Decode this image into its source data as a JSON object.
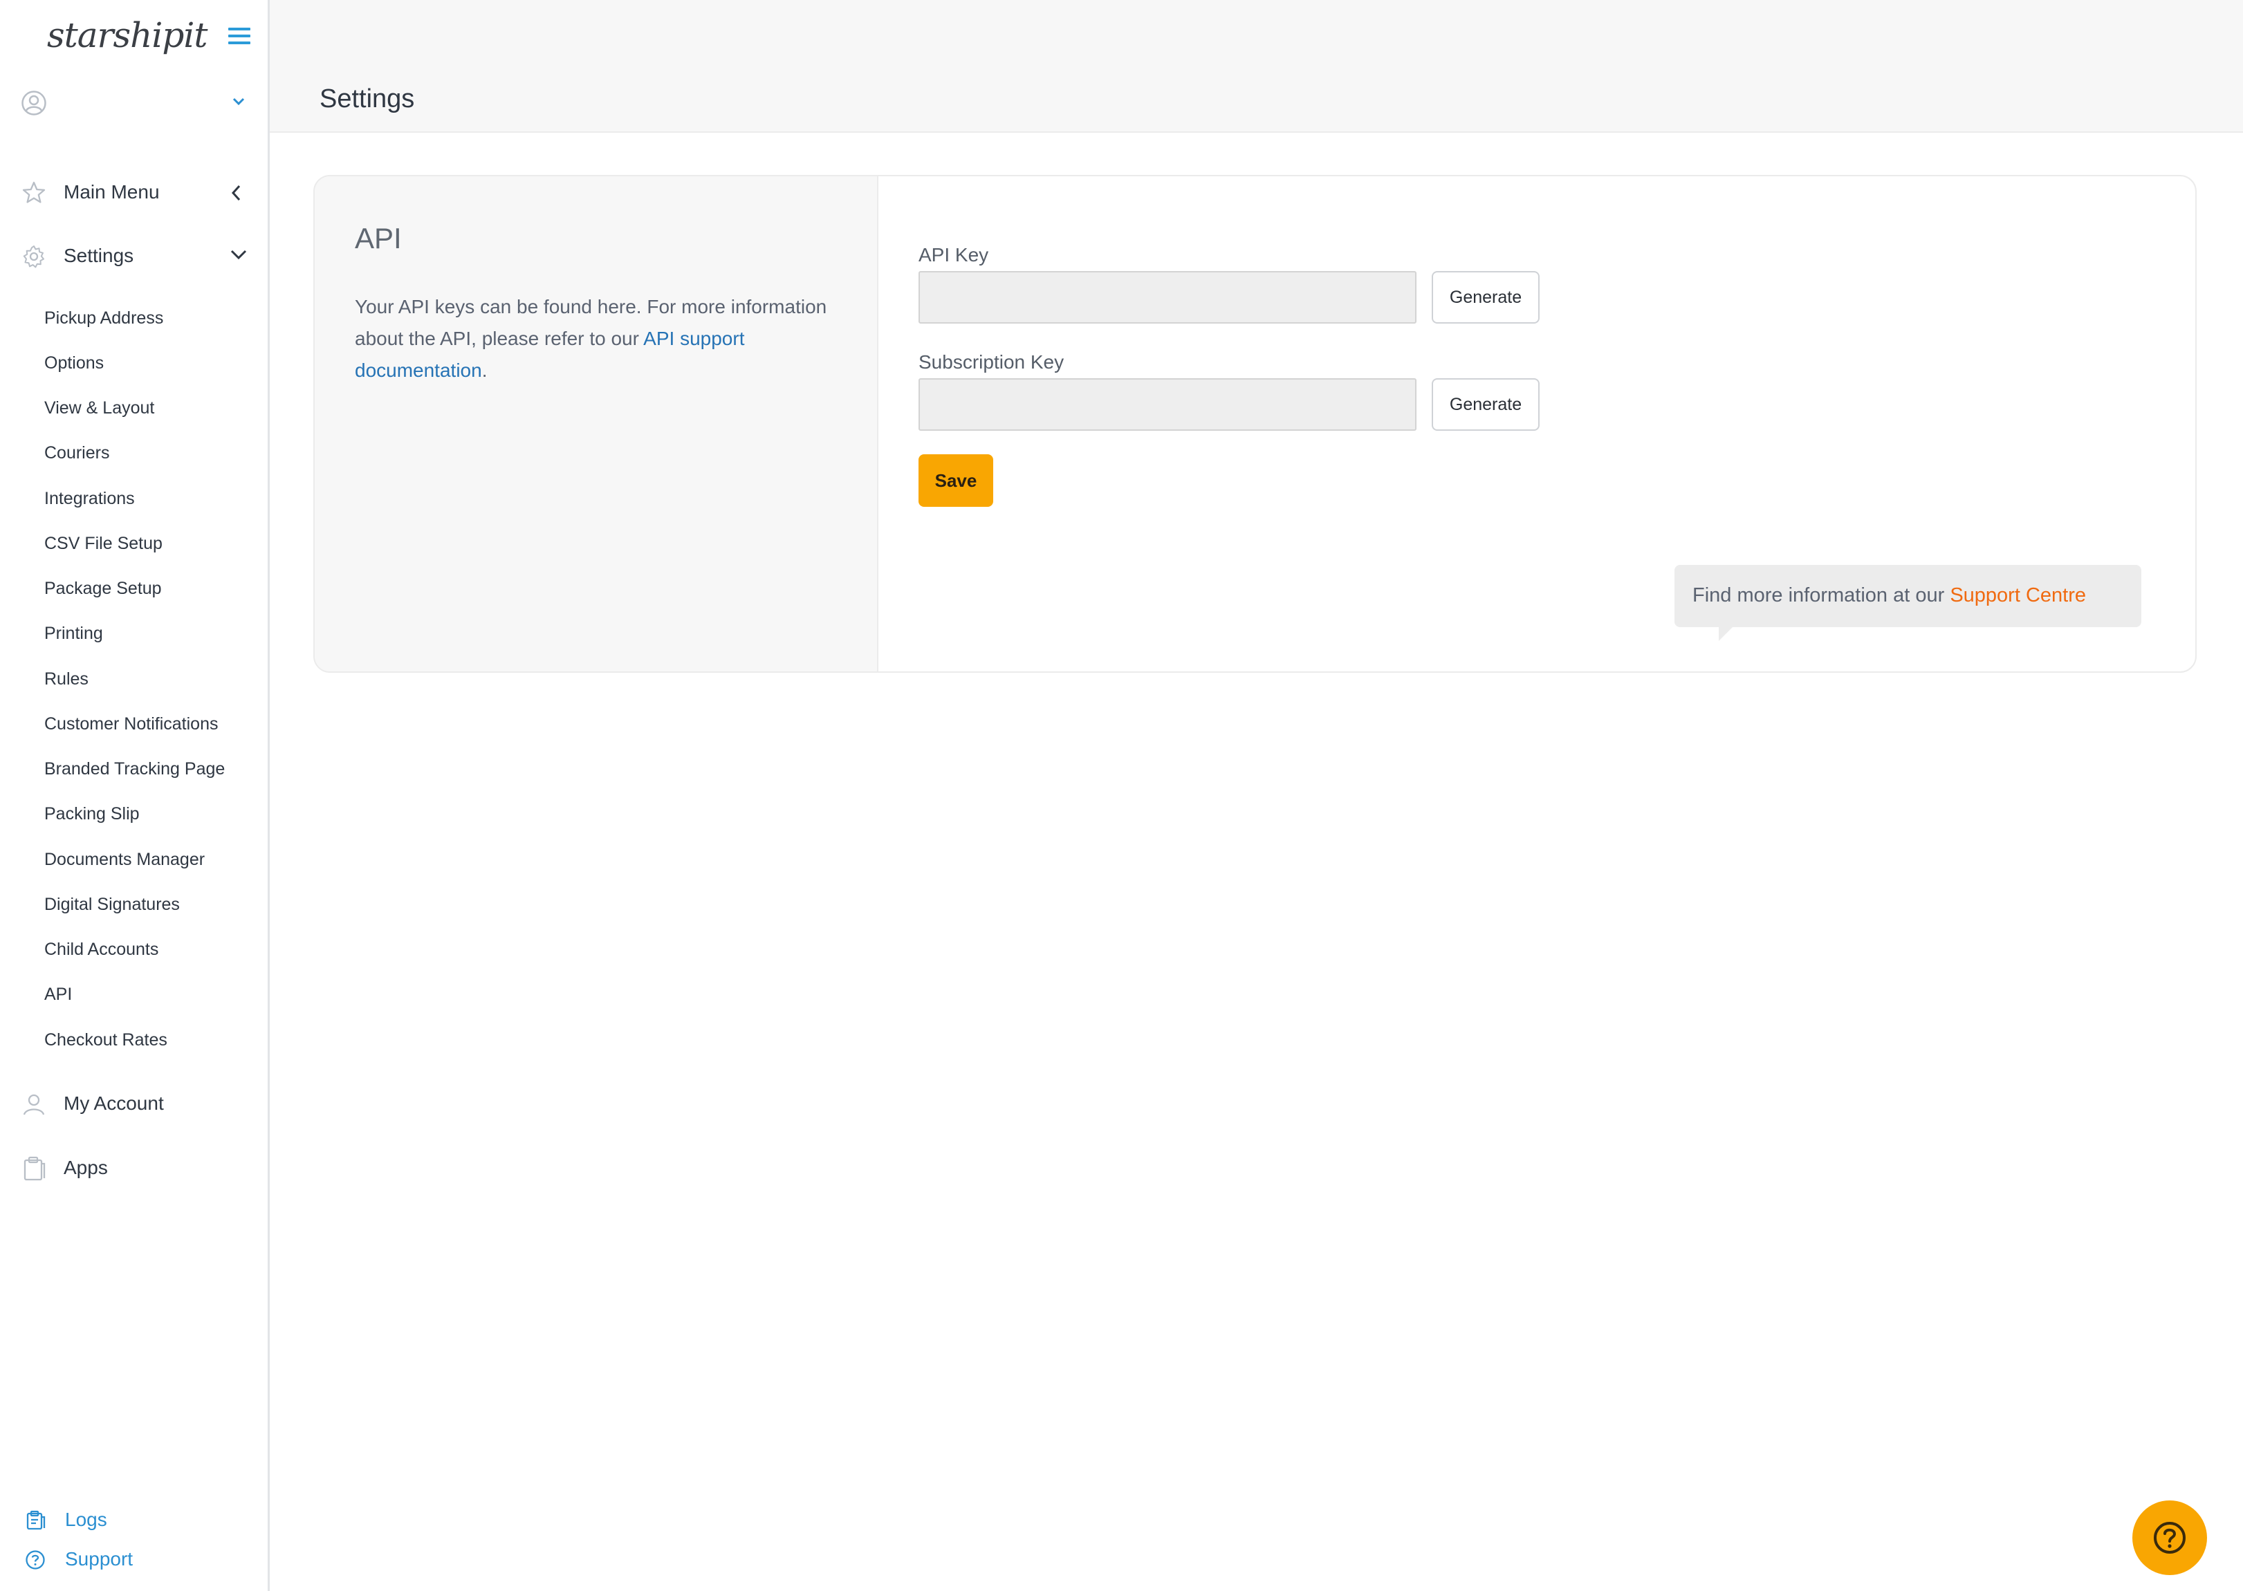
{
  "sidebar": {
    "logo": "starshipit",
    "main_menu": "Main Menu",
    "settings": "Settings",
    "settings_items": [
      "Pickup Address",
      "Options",
      "View & Layout",
      "Couriers",
      "Integrations",
      "CSV File Setup",
      "Package Setup",
      "Printing",
      "Rules",
      "Customer Notifications",
      "Branded Tracking Page",
      "Packing Slip",
      "Documents Manager",
      "Digital Signatures",
      "Child Accounts",
      "API",
      "Checkout Rates"
    ],
    "my_account": "My Account",
    "apps": "Apps",
    "footer": {
      "logs": "Logs",
      "support": "Support"
    }
  },
  "header": {
    "title": "Settings"
  },
  "api_section": {
    "title": "API",
    "description_prefix": "Your API keys can be found here. For more information about the API, please refer to our ",
    "description_link": "API support documentation",
    "description_suffix": ".",
    "api_key_label": "API Key",
    "api_key_value": "",
    "subscription_key_label": "Subscription Key",
    "subscription_key_value": "",
    "generate_label": "Generate",
    "save_label": "Save"
  },
  "info": {
    "text": "Find more information at our ",
    "link": "Support Centre"
  },
  "colors": {
    "accent": "#f9a602",
    "link_blue": "#2673b5",
    "link_orange": "#f06a10",
    "nav_blue": "#2b9bd9"
  },
  "icons": {
    "hamburger": "hamburger-menu-icon",
    "avatar": "user-circle-icon",
    "main_menu": "star-icon",
    "settings": "gear-icon",
    "my_account": "person-icon",
    "apps": "clipboard-icon",
    "logs": "clipboard-list-icon",
    "support": "question-circle-icon",
    "help": "help-question-icon"
  }
}
